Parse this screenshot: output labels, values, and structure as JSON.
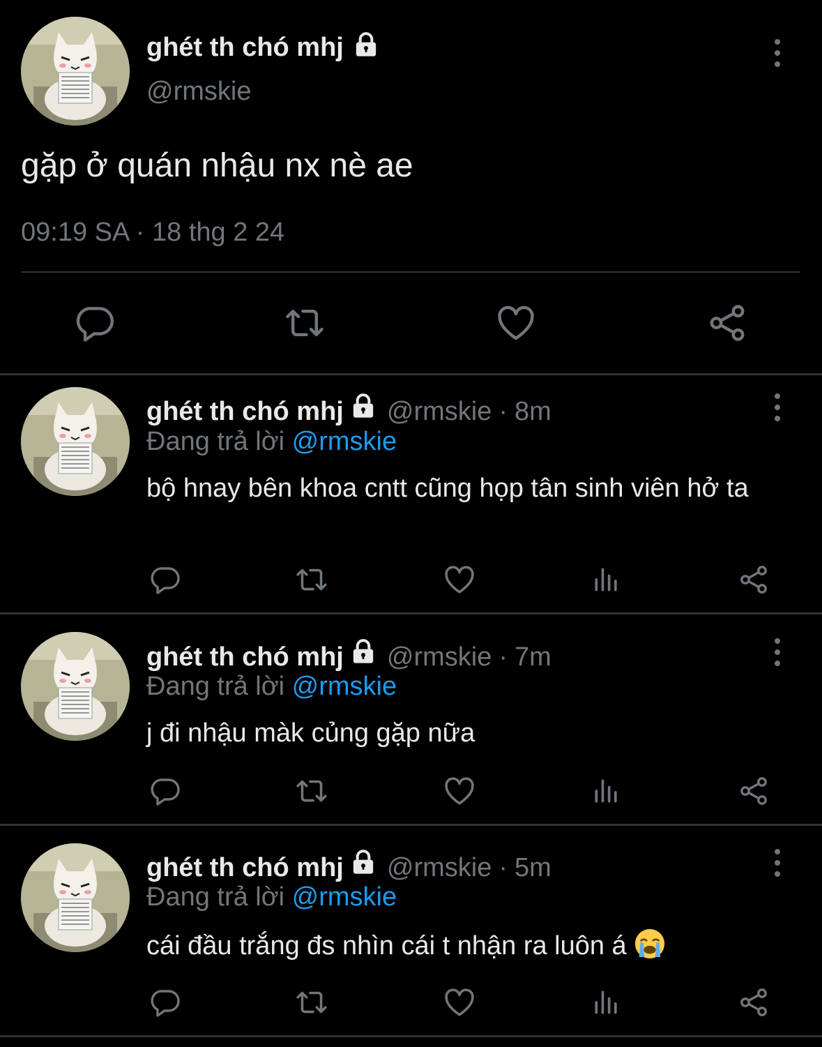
{
  "main_tweet": {
    "display_name": "ghét th chó mhj",
    "handle": "@rmskie",
    "text": "gặp ở quán nhậu nx nè ae",
    "timestamp": "09:19 SA · 18 thg 2 24"
  },
  "replies": [
    {
      "display_name": "ghét th chó mhj",
      "handle": "@rmskie",
      "separator": "·",
      "time": "8m",
      "replying_label": "Đang trả lời",
      "replying_to": "@rmskie",
      "text": "bộ hnay bên khoa cntt cũng họp tân sinh viên hở ta"
    },
    {
      "display_name": "ghét th chó mhj",
      "handle": "@rmskie",
      "separator": "·",
      "time": "7m",
      "replying_label": "Đang trả lời",
      "replying_to": "@rmskie",
      "text": "j đi nhậu màk củng gặp nữa"
    },
    {
      "display_name": "ghét th chó mhj",
      "handle": "@rmskie",
      "separator": "·",
      "time": "5m",
      "replying_label": "Đang trả lời",
      "replying_to": "@rmskie",
      "text": "cái đầu trắng đs nhìn cái t nhận ra luôn á"
    }
  ],
  "icons": {
    "reply": "reply-icon",
    "retweet": "retweet-icon",
    "like": "heart-icon",
    "views": "views-icon",
    "share": "share-icon",
    "lock": "lock-icon",
    "more": "more-icon",
    "crying_emoji": "crying-face-emoji"
  },
  "colors": {
    "background": "#000000",
    "text": "#e7e9ea",
    "muted": "#71767b",
    "accent": "#1d9bf0",
    "divider": "#2f3336"
  }
}
